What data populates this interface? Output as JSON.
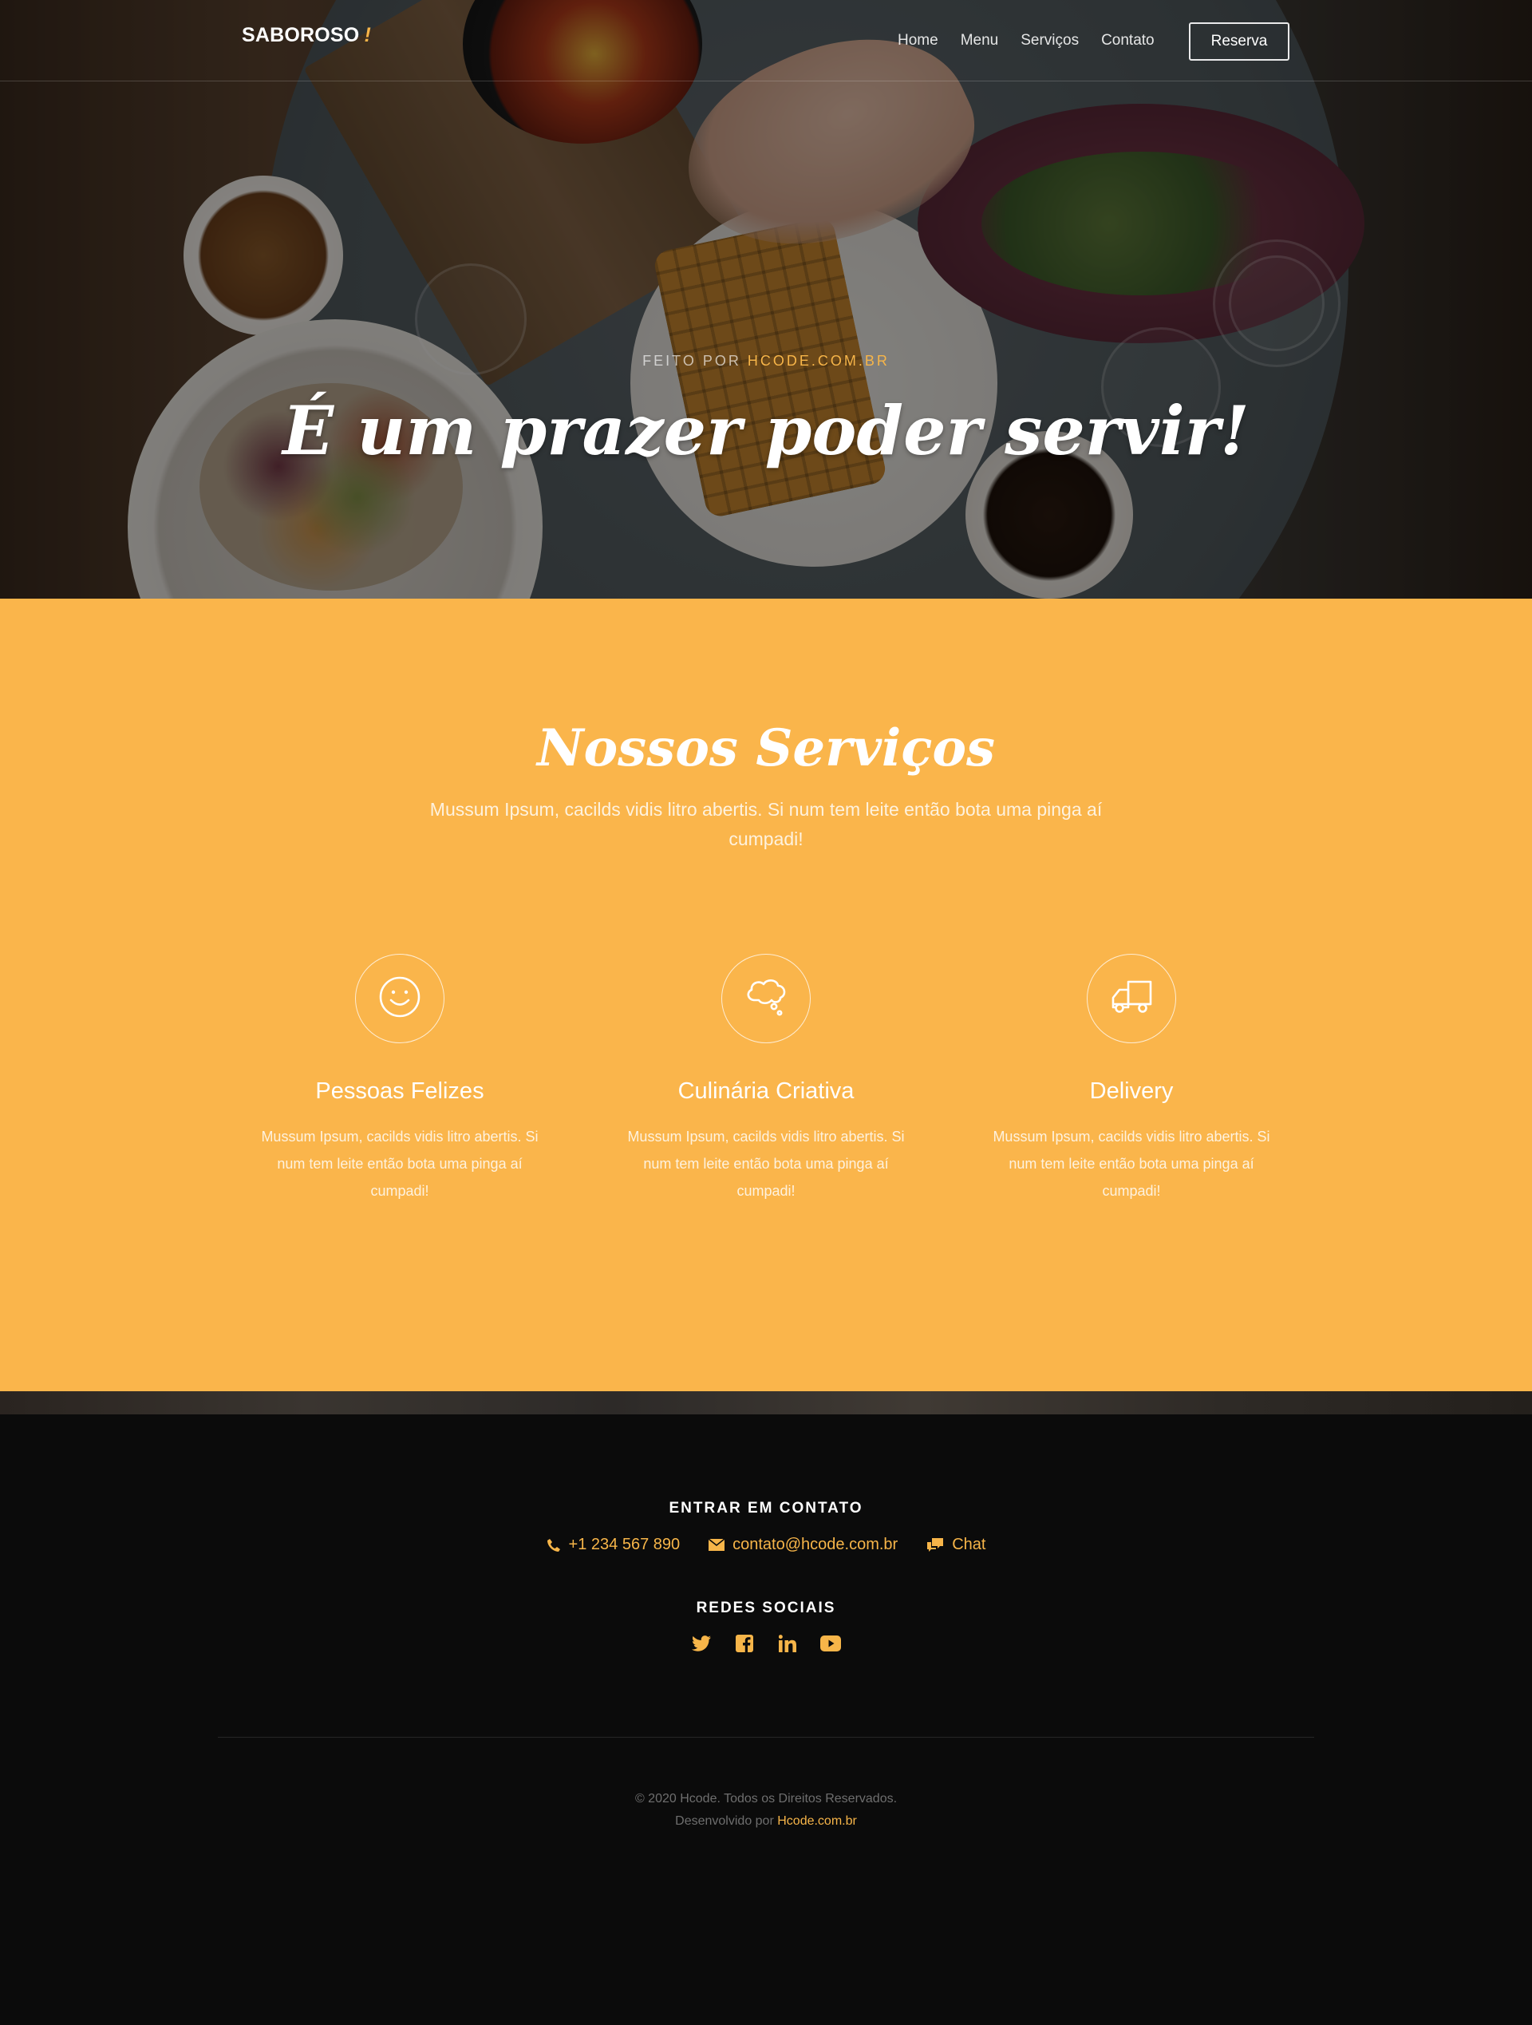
{
  "navbar": {
    "brand": "SABOROSO",
    "brand_accent": "!",
    "links": [
      "Home",
      "Menu",
      "Serviços",
      "Contato"
    ],
    "cta_label": "Reserva"
  },
  "hero": {
    "subtitle_prefix": "FEITO POR",
    "subtitle_highlight": "HCODE.COM.BR",
    "title": "É um prazer poder servir!"
  },
  "services": {
    "title": "Nossos Serviços",
    "intro": "Mussum Ipsum, cacilds vidis litro abertis. Si num tem leite então bota uma pinga aí cumpadi!",
    "items": [
      {
        "icon": "smiley-icon",
        "title": "Pessoas Felizes",
        "description": "Mussum Ipsum, cacilds vidis litro abertis. Si num tem leite então bota uma pinga aí cumpadi!"
      },
      {
        "icon": "thought-bubble-icon",
        "title": "Culinária Criativa",
        "description": "Mussum Ipsum, cacilds vidis litro abertis. Si num tem leite então bota uma pinga aí cumpadi!"
      },
      {
        "icon": "truck-icon",
        "title": "Delivery",
        "description": "Mussum Ipsum, cacilds vidis litro abertis. Si num tem leite então bota uma pinga aí cumpadi!"
      }
    ]
  },
  "footer": {
    "contact_heading": "ENTRAR EM CONTATO",
    "phone": "+1 234 567 890",
    "email": "contato@hcode.com.br",
    "chat": "Chat",
    "social_heading": "REDES SOCIAIS",
    "social_icons": [
      "twitter-icon",
      "facebook-icon",
      "linkedin-icon",
      "youtube-icon"
    ],
    "copyright": "© 2020 Hcode. Todos os Direitos Reservados.",
    "credit_prefix": "Desenvolvido por",
    "credit_link": "Hcode.com.br"
  },
  "colors": {
    "accent": "#f7b549",
    "services_bg": "#fab54b",
    "footer_bg": "#0b0b0b"
  }
}
